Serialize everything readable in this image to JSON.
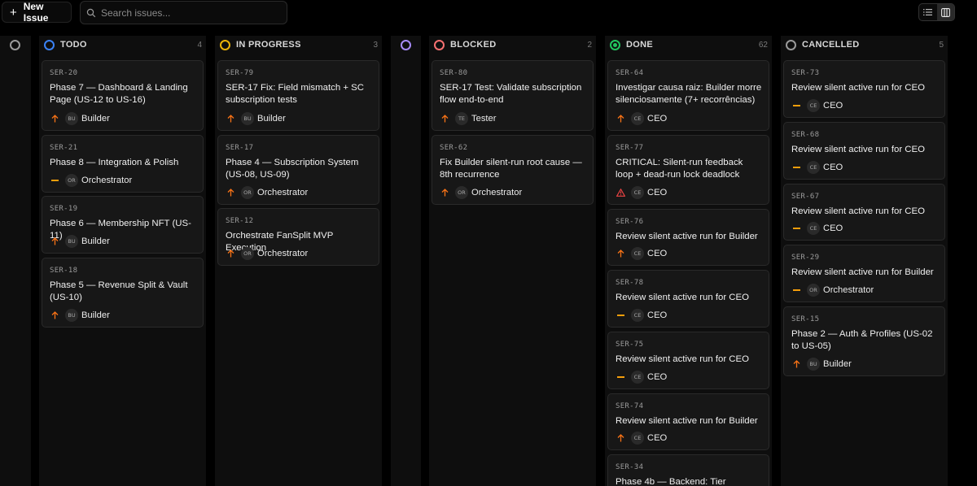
{
  "toolbar": {
    "new_issue_label": "New Issue",
    "search_placeholder": "Search issues..."
  },
  "columns": [
    {
      "key": "backlog",
      "label": "",
      "count": "",
      "color": "#9a9a9a"
    },
    {
      "key": "todo",
      "label": "TODO",
      "count": "4",
      "color": "#3b82f6"
    },
    {
      "key": "in_progress",
      "label": "IN PROGRESS",
      "count": "3",
      "color": "#eab308"
    },
    {
      "key": "review",
      "label": "",
      "count": "",
      "color": "#a78bfa"
    },
    {
      "key": "blocked",
      "label": "BLOCKED",
      "count": "2",
      "color": "#f87171"
    },
    {
      "key": "done",
      "label": "DONE",
      "count": "62",
      "color": "#22c55e"
    },
    {
      "key": "cancelled",
      "label": "CANCELLED",
      "count": "5",
      "color": "#9a9a9a"
    }
  ],
  "cards": {
    "todo": [
      {
        "id": "SER-20",
        "title": "Phase 7 — Dashboard & Landing Page (US-12 to US-16)",
        "priority": "high",
        "avatar": "BU",
        "assignee": "Builder"
      },
      {
        "id": "SER-21",
        "title": "Phase 8 — Integration & Polish",
        "priority": "medium",
        "avatar": "OR",
        "assignee": "Orchestrator"
      },
      {
        "id": "SER-19",
        "title": "Phase 6 — Membership NFT (US-11)",
        "priority": "high",
        "avatar": "BU",
        "assignee": "Builder"
      },
      {
        "id": "SER-18",
        "title": "Phase 5 — Revenue Split & Vault (US-10)",
        "priority": "high",
        "avatar": "BU",
        "assignee": "Builder"
      }
    ],
    "in_progress": [
      {
        "id": "SER-79",
        "title": "SER-17 Fix: Field mismatch + SC subscription tests",
        "priority": "high",
        "avatar": "BU",
        "assignee": "Builder"
      },
      {
        "id": "SER-17",
        "title": "Phase 4 — Subscription System (US-08, US-09)",
        "priority": "high",
        "avatar": "OR",
        "assignee": "Orchestrator"
      },
      {
        "id": "SER-12",
        "title": "Orchestrate FanSplit MVP Execution",
        "priority": "high",
        "avatar": "OR",
        "assignee": "Orchestrator"
      }
    ],
    "blocked": [
      {
        "id": "SER-80",
        "title": "SER-17 Test: Validate subscription flow end-to-end",
        "priority": "high",
        "avatar": "TE",
        "assignee": "Tester"
      },
      {
        "id": "SER-62",
        "title": "Fix Builder silent-run root cause — 8th recurrence",
        "priority": "high",
        "avatar": "OR",
        "assignee": "Orchestrator"
      }
    ],
    "done": [
      {
        "id": "SER-64",
        "title": "Investigar causa raiz: Builder morre silenciosamente (7+ recorrências)",
        "priority": "high",
        "avatar": "CE",
        "assignee": "CEO"
      },
      {
        "id": "SER-77",
        "title": "CRITICAL: Silent-run feedback loop + dead-run lock deadlock",
        "priority": "urgent",
        "avatar": "CE",
        "assignee": "CEO"
      },
      {
        "id": "SER-76",
        "title": "Review silent active run for Builder",
        "priority": "high",
        "avatar": "CE",
        "assignee": "CEO"
      },
      {
        "id": "SER-78",
        "title": "Review silent active run for CEO",
        "priority": "medium",
        "avatar": "CE",
        "assignee": "CEO"
      },
      {
        "id": "SER-75",
        "title": "Review silent active run for CEO",
        "priority": "medium",
        "avatar": "CE",
        "assignee": "CEO"
      },
      {
        "id": "SER-74",
        "title": "Review silent active run for Builder",
        "priority": "high",
        "avatar": "CE",
        "assignee": "CEO"
      },
      {
        "id": "SER-34",
        "title": "Phase 4b — Backend: Tier",
        "priority": "",
        "avatar": "",
        "assignee": ""
      }
    ],
    "cancelled": [
      {
        "id": "SER-73",
        "title": "Review silent active run for CEO",
        "priority": "medium",
        "avatar": "CE",
        "assignee": "CEO"
      },
      {
        "id": "SER-68",
        "title": "Review silent active run for CEO",
        "priority": "medium",
        "avatar": "CE",
        "assignee": "CEO"
      },
      {
        "id": "SER-67",
        "title": "Review silent active run for CEO",
        "priority": "medium",
        "avatar": "CE",
        "assignee": "CEO"
      },
      {
        "id": "SER-29",
        "title": "Review silent active run for Builder",
        "priority": "medium",
        "avatar": "OR",
        "assignee": "Orchestrator"
      },
      {
        "id": "SER-15",
        "title": "Phase 2 — Auth & Profiles (US-02 to US-05)",
        "priority": "high",
        "avatar": "BU",
        "assignee": "Builder"
      }
    ]
  },
  "colors": {
    "priority_high": "#f97316",
    "priority_medium": "#f59e0b",
    "priority_urgent": "#ef4444"
  },
  "icons": {
    "high": "arrow-up-icon",
    "medium": "dash-icon",
    "urgent": "warning-triangle-icon",
    "search": "search-icon",
    "plus": "plus-icon",
    "list_view": "list-view-icon",
    "board_view": "board-view-icon"
  }
}
